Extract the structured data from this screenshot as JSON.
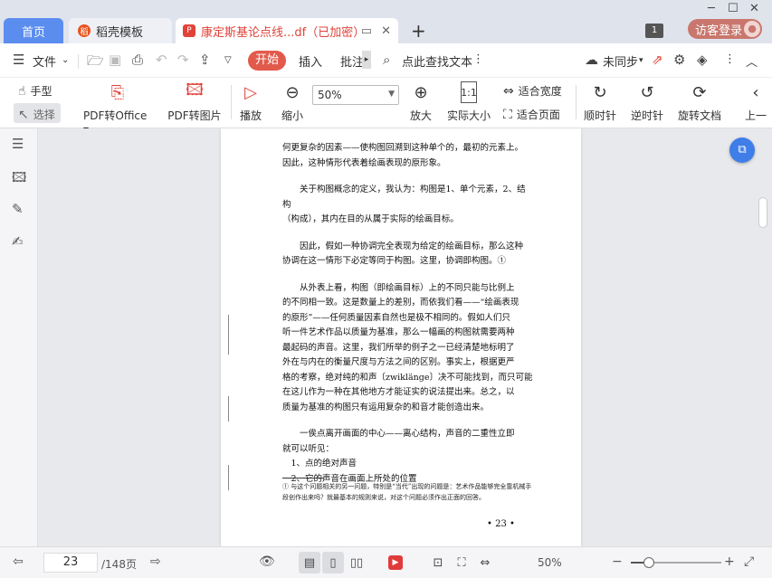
{
  "tabs": {
    "home": "首页",
    "templates": "稻壳模板",
    "doc": "康定斯基论点线...df（已加密）"
  },
  "titlebar": {
    "badge": "1",
    "login": "访客登录"
  },
  "menu": {
    "file": "文件",
    "start": "开始",
    "insert": "插入",
    "annotate": "批注",
    "search": "点此查找文本",
    "sync": "未同步"
  },
  "ribbon": {
    "hand": "手型",
    "select": "选择",
    "pdf_office": "PDF转Office",
    "pdf_image": "PDF转图片",
    "play": "播放",
    "zoom_out": "缩小",
    "zoom_value": "50%",
    "zoom_in": "放大",
    "actual_size": "实际大小",
    "fit_width": "适合宽度",
    "fit_page": "适合页面",
    "rotate_cw": "顺时针",
    "rotate_ccw": "逆时针",
    "rotate_doc": "旋转文档",
    "prev": "上一"
  },
  "page": {
    "lines": [
      {
        "cls": "noi",
        "text": "何更复杂的因素——使构图回溯到这种单个的，最初的元素上。"
      },
      {
        "cls": "noi",
        "text": "因此，这种情形代表着绘画表现的原形象。"
      },
      {
        "cls": "gap",
        "text": ""
      },
      {
        "cls": "",
        "text": "关于构图概念的定义，我认为：构图是1、单个元素，2、结构"
      },
      {
        "cls": "noi",
        "text": "（构成），其内在目的从属于实际的绘画目标。"
      },
      {
        "cls": "gap",
        "text": ""
      },
      {
        "cls": "",
        "text": "因此，假如一种协调完全表现为给定的绘画目标，那么这种"
      },
      {
        "cls": "noi",
        "text": "协调在这一情形下必定等同于构图。这里，协调即构图。①"
      },
      {
        "cls": "gap",
        "text": ""
      },
      {
        "cls": "",
        "text": "从外表上看，构图（即绘画目标）上的不同只能与比例上"
      },
      {
        "cls": "noi",
        "text": "的不同相一致。这是数量上的差别，而依我们看——“绘画表现"
      },
      {
        "cls": "noi",
        "text": "的原形”——任何质量因素自然也是极不相同的。假如人们只"
      },
      {
        "cls": "noi",
        "text": "听一件艺术作品以质量为基准，那么一幅画的构图就需要两种"
      },
      {
        "cls": "noi",
        "text": "最起码的声音。这里，我们所举的例子之一已经清楚地标明了"
      },
      {
        "cls": "noi",
        "text": "外在与内在的衡量尺度与方法之间的区别。事实上，根据更严"
      },
      {
        "cls": "noi",
        "text": "格的考察，绝对纯的和声〔zwiklänge〕决不可能找到，而只可能"
      },
      {
        "cls": "noi",
        "text": "在这儿作为一种在其他地方才能证实的说法提出来。总之，以"
      },
      {
        "cls": "noi",
        "text": "质量为基准的构图只有运用复杂的和音才能创造出来。"
      },
      {
        "cls": "gap",
        "text": ""
      },
      {
        "cls": "",
        "text": "一俟点离开画面的中心——离心结构，声音的二重性立即"
      },
      {
        "cls": "noi",
        "text": "就可以听见："
      },
      {
        "cls": "li",
        "text": "1、点的绝对声音"
      },
      {
        "cls": "li",
        "text": "2、它的声音在画面上所处的位置"
      }
    ],
    "footnote": "① 与这个问题相关的另一问题，特别是“当代”出现的问题是：艺术作品能够完全靠机械手段创作出来吗？就最基本的规则来说，对这个问题必须作出正面的回答。",
    "number": "• 23 •"
  },
  "status": {
    "page_current": "23",
    "page_total": "/148页",
    "zoom": "50%",
    "zoom_fraction": 0.2
  }
}
